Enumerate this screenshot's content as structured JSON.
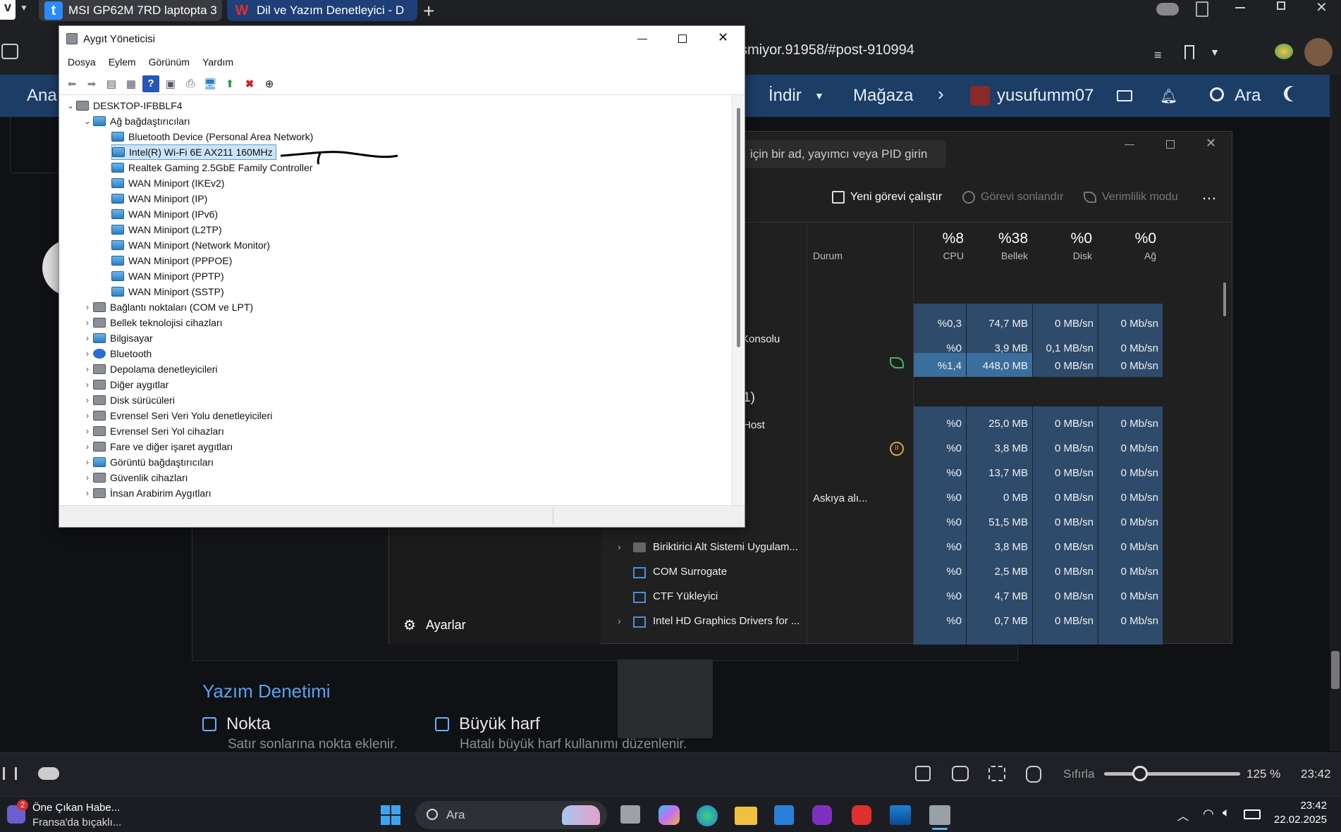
{
  "browser": {
    "tabs": [
      {
        "label": "MSI GP62M 7RD laptopta 3",
        "favicon": "t"
      },
      {
        "label": "Dil ve Yazım Denetleyici - D",
        "favicon": "W"
      }
    ],
    "url": "smiyor.91958/#post-910994"
  },
  "site_nav": {
    "home": "Ana",
    "download": "İndir",
    "store": "Mağaza",
    "username": "yusufumm07",
    "search": "Ara"
  },
  "device_manager": {
    "title": "Aygıt Yöneticisi",
    "menu": [
      "Dosya",
      "Eylem",
      "Görünüm",
      "Yardım"
    ],
    "root": "DESKTOP-IFBBLF4",
    "network_category": "Ağ bağdaştırıcıları",
    "network_items": [
      "Bluetooth Device (Personal Area Network)",
      "Intel(R) Wi-Fi 6E AX211 160MHz",
      "Realtek Gaming 2.5GbE Family Controller",
      "WAN Miniport (IKEv2)",
      "WAN Miniport (IP)",
      "WAN Miniport (IPv6)",
      "WAN Miniport (L2TP)",
      "WAN Miniport (Network Monitor)",
      "WAN Miniport (PPPOE)",
      "WAN Miniport (PPTP)",
      "WAN Miniport (SSTP)"
    ],
    "categories": [
      "Bağlantı noktaları (COM ve LPT)",
      "Bellek teknolojisi cihazları",
      "Bilgisayar",
      "Bluetooth",
      "Depolama denetleyicileri",
      "Diğer aygıtlar",
      "Disk sürücüleri",
      "Evrensel Seri Veri Yolu denetleyicileri",
      "Evrensel Seri Yol cihazları",
      "Fare ve diğer işaret aygıtları",
      "Görüntü bağdaştırıcıları",
      "Güvenlik cihazları",
      "İnsan Arabirim Aygıtları"
    ]
  },
  "task_manager": {
    "search_placeholder": "için bir ad, yayımcı veya PID girin",
    "actions": {
      "run": "Yeni görevi çalıştır",
      "end": "Görevi sonlandır",
      "efficiency": "Verimlilik modu"
    },
    "columns": {
      "status": "Durum",
      "cpu_pct": "%8",
      "cpu": "CPU",
      "mem_pct": "%38",
      "mem": "Bellek",
      "disk_pct": "%0",
      "disk": "Disk",
      "net_pct": "%0",
      "net": "Ağ"
    },
    "partial_names": [
      "Konsolu",
      "1)",
      "Host"
    ],
    "suspended_status": "Askıya alı...",
    "rows": [
      {
        "name": "",
        "cpu": "%0,3",
        "mem": "74,7 MB",
        "disk": "0 MB/sn",
        "net": "0 Mb/sn"
      },
      {
        "name": "",
        "cpu": "%0",
        "mem": "3,9 MB",
        "disk": "0,1 MB/sn",
        "net": "0 Mb/sn"
      },
      {
        "name": "",
        "cpu": "%1,4",
        "mem": "448,0 MB",
        "disk": "0 MB/sn",
        "net": "0 Mb/sn"
      },
      {
        "name": "",
        "cpu": "%0",
        "mem": "25,0 MB",
        "disk": "0 MB/sn",
        "net": "0 Mb/sn"
      },
      {
        "name": "",
        "cpu": "%0",
        "mem": "3,8 MB",
        "disk": "0 MB/sn",
        "net": "0 Mb/sn"
      },
      {
        "name": "",
        "cpu": "%0",
        "mem": "13,7 MB",
        "disk": "0 MB/sn",
        "net": "0 Mb/sn"
      },
      {
        "name": "",
        "cpu": "%0",
        "mem": "0 MB",
        "disk": "0 MB/sn",
        "net": "0 Mb/sn"
      },
      {
        "name": "",
        "cpu": "%0",
        "mem": "51,5 MB",
        "disk": "0 MB/sn",
        "net": "0 Mb/sn"
      },
      {
        "name": "Biriktirici Alt Sistemi Uygulam...",
        "cpu": "%0",
        "mem": "3,8 MB",
        "disk": "0 MB/sn",
        "net": "0 Mb/sn"
      },
      {
        "name": "COM Surrogate",
        "cpu": "%0",
        "mem": "2,5 MB",
        "disk": "0 MB/sn",
        "net": "0 Mb/sn"
      },
      {
        "name": "CTF Yükleyici",
        "cpu": "%0",
        "mem": "4,7 MB",
        "disk": "0 MB/sn",
        "net": "0 Mb/sn"
      },
      {
        "name": "Intel HD Graphics Drivers for ...",
        "cpu": "%0",
        "mem": "0,7 MB",
        "disk": "0 MB/sn",
        "net": "0 Mb/sn"
      }
    ],
    "settings": "Ayarlar"
  },
  "page": {
    "section_title": "Yazım Denetimi",
    "options": [
      {
        "label": "Nokta",
        "desc": "Satır sonlarına nokta eklenir."
      },
      {
        "label": "Büyük harf",
        "desc": "Hatalı büyük harf kullanımı düzenlenir."
      }
    ]
  },
  "browser_status": {
    "reset": "Sıfırla",
    "zoom": "125 %",
    "time": "23:42"
  },
  "taskbar": {
    "news_badge": "2",
    "news_title": "Öne Çıkan Habe...",
    "news_sub": "Fransa'da bıçaklı...",
    "search": "Ara",
    "time": "23:42",
    "date": "22.02.2025"
  }
}
